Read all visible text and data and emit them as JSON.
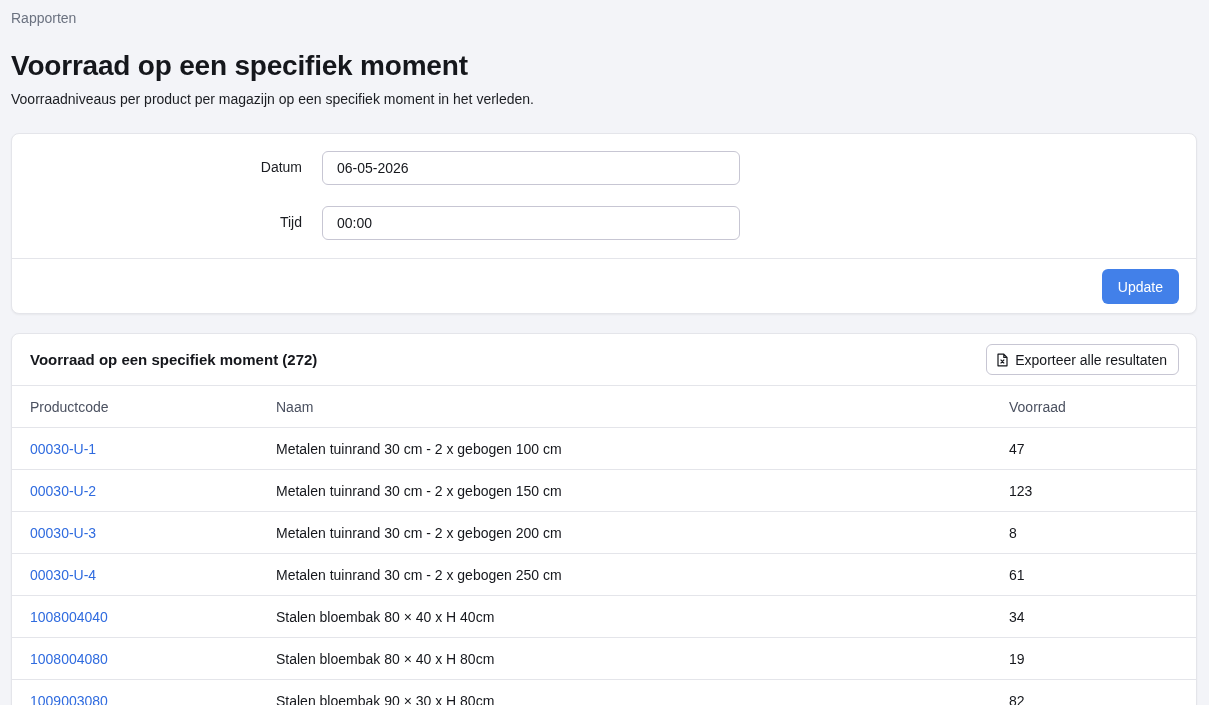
{
  "breadcrumb": "Rapporten",
  "page": {
    "title": "Voorraad op een specifiek moment",
    "description": "Voorraadniveaus per product per magazijn op een specifiek moment in het verleden."
  },
  "filters": {
    "fields": [
      {
        "label": "Datum",
        "value": "06-05-2026"
      },
      {
        "label": "Tijd",
        "value": "00:00"
      }
    ],
    "submit_button": "Update"
  },
  "results": {
    "title": "Voorraad op een specifiek moment (272)",
    "export_button": "Exporteer alle resultaten",
    "table": {
      "columns": [
        "Productcode",
        "Naam",
        "Voorraad"
      ],
      "rows": [
        {
          "productcode": "00030-U-1",
          "naam": "Metalen tuinrand 30 cm - 2 x gebogen 100 cm",
          "voorraad": "47"
        },
        {
          "productcode": "00030-U-2",
          "naam": "Metalen tuinrand 30 cm - 2 x gebogen 150 cm",
          "voorraad": "123"
        },
        {
          "productcode": "00030-U-3",
          "naam": "Metalen tuinrand 30 cm - 2 x gebogen 200 cm",
          "voorraad": "8"
        },
        {
          "productcode": "00030-U-4",
          "naam": "Metalen tuinrand 30 cm - 2 x gebogen 250 cm",
          "voorraad": "61"
        },
        {
          "productcode": "1008004040",
          "naam": "Stalen bloembak 80 × 40 x H 40cm",
          "voorraad": "34"
        },
        {
          "productcode": "1008004080",
          "naam": "Stalen bloembak 80 × 40 x H 80cm",
          "voorraad": "19"
        },
        {
          "productcode": "1009003080",
          "naam": "Stalen bloembak 90 × 30 x H 80cm",
          "voorraad": "82"
        }
      ]
    }
  }
}
